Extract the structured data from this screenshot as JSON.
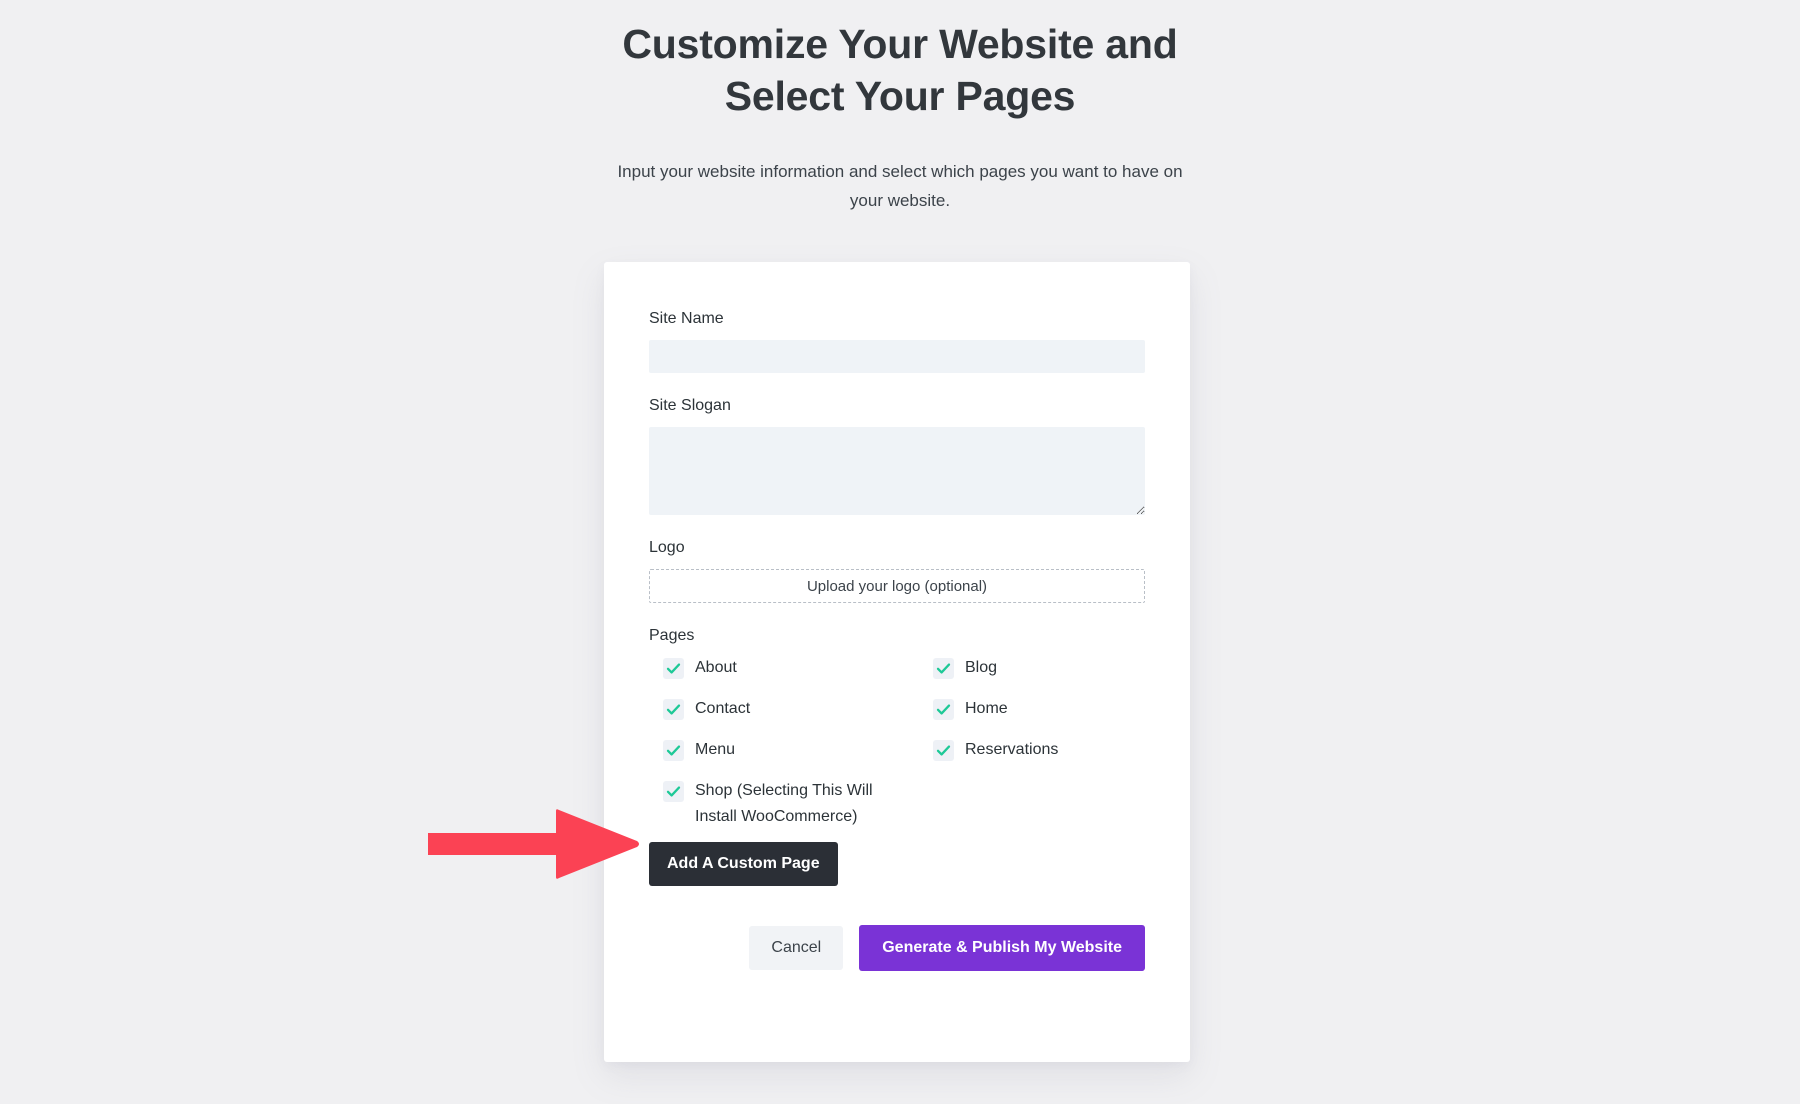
{
  "header": {
    "title_line1": "Customize Your Website and",
    "title_line2": "Select Your Pages",
    "subtitle": "Input your website information and select which pages you want to have on your website."
  },
  "form": {
    "site_name": {
      "label": "Site Name",
      "value": "",
      "placeholder": ""
    },
    "site_slogan": {
      "label": "Site Slogan",
      "value": "",
      "placeholder": ""
    },
    "logo": {
      "label": "Logo",
      "upload_text": "Upload your logo (optional)"
    },
    "pages": {
      "label": "Pages",
      "options": [
        {
          "label": "About",
          "checked": true
        },
        {
          "label": "Blog",
          "checked": true
        },
        {
          "label": "Contact",
          "checked": true
        },
        {
          "label": "Home",
          "checked": true
        },
        {
          "label": "Menu",
          "checked": true
        },
        {
          "label": "Reservations",
          "checked": true
        },
        {
          "label": "Shop (Selecting This Will Install WooCommerce)",
          "checked": true
        }
      ]
    },
    "add_custom_page_label": "Add A Custom Page",
    "cancel_label": "Cancel",
    "generate_label": "Generate & Publish My Website"
  },
  "annotation": {
    "arrow_name": "red-arrow-pointing-to-shop-option",
    "arrow_color": "#fb4254"
  },
  "colors": {
    "page_background": "#f0f0f2",
    "card_background": "#ffffff",
    "input_background": "#eff3f7",
    "checkbox_background": "#eef1f6",
    "checkmark": "#1ec997",
    "dark_button": "#2b2f36",
    "primary_button": "#7a33d6",
    "cancel_button": "#f1f3f6",
    "text": "#2c3338"
  }
}
